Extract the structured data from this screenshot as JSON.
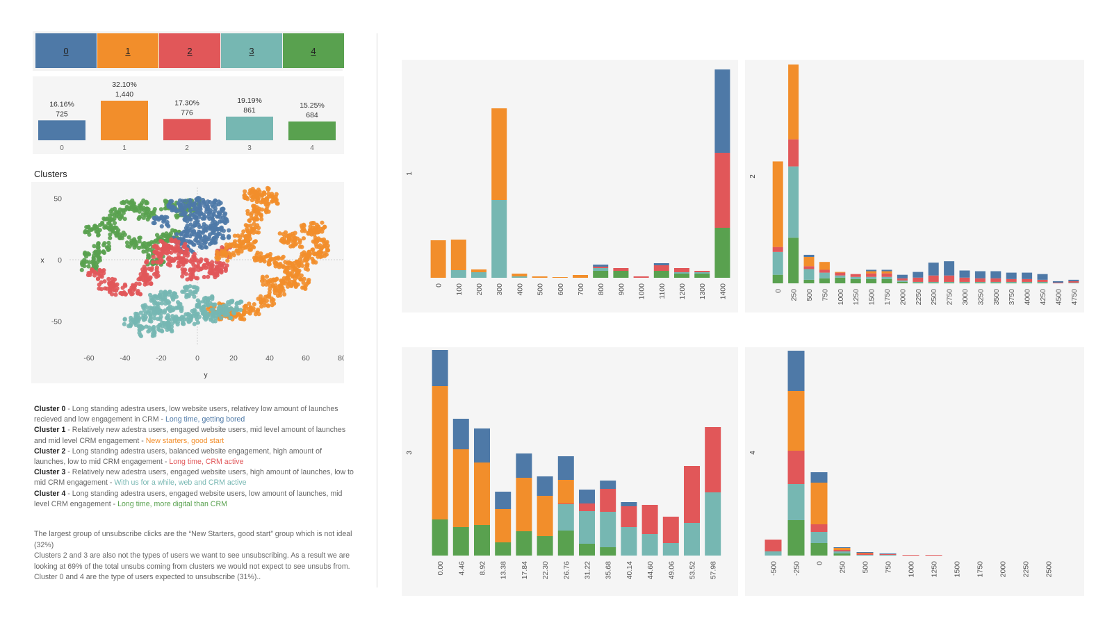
{
  "colors": {
    "c0": "#4e79a7",
    "c1": "#f28e2b",
    "c2": "#e15759",
    "c3": "#76b7b2",
    "c4": "#59a14f"
  },
  "legend": [
    "0",
    "1",
    "2",
    "3",
    "4"
  ],
  "cluster_counts": {
    "type": "bar",
    "categories": [
      "0",
      "1",
      "2",
      "3",
      "4"
    ],
    "percents": [
      "16.16%",
      "32.10%",
      "17.30%",
      "19.19%",
      "15.25%"
    ],
    "counts": [
      "725",
      "1,440",
      "776",
      "861",
      "684"
    ],
    "values": [
      725,
      1440,
      776,
      861,
      684
    ]
  },
  "clusters_title": "Clusters",
  "scatter": {
    "type": "scatter",
    "xlabel": "y",
    "ylabel": "x",
    "xticks": [
      "-60",
      "-40",
      "-20",
      "0",
      "20",
      "40",
      "60",
      "80"
    ],
    "yticks": [
      "50",
      "0",
      "-50"
    ],
    "xlim": [
      -80,
      80
    ],
    "ylim": [
      -75,
      60
    ]
  },
  "descriptions": [
    {
      "title": "Cluster 0",
      "text": " - Long standing adestra users, low website users, relativey low amount of launches recieved and low engagement in CRM - ",
      "tag": "Long time, getting bored",
      "color": "#4e79a7"
    },
    {
      "title": "Cluster 1",
      "text": " - Relatively new adestra users, engaged website users, mid level amount of launches and mid level CRM engagement - ",
      "tag": "New starters, good start",
      "color": "#f28e2b"
    },
    {
      "title": "Cluster 2",
      "text": " - Long standing adestra users, balanced website engagement, high amount of launches, low to mid CRM engagement - ",
      "tag": "Long time, CRM active",
      "color": "#e15759"
    },
    {
      "title": "Cluster 3",
      "text": " - Relatively new adestra users, engaged website users, high amount of launches, low to mid CRM engagement - ",
      "tag": "With us for a while, web and CRM active",
      "color": "#76b7b2"
    },
    {
      "title": "Cluster 4",
      "text": " - Long standing adestra users, engaged website users, low amount of launches, mid level CRM engagement - ",
      "tag": "Long time, more digital than CRM",
      "color": "#59a14f"
    }
  ],
  "summary": [
    "The largest group of unsubscribe clicks are the “New Starters, good start” group which is not ideal (32%)",
    "Clusters 2 and 3 are also not the types of users we want to see unsubscribing. As a result we are looking at 69% of the total unsubs coming from clusters we would not expect to see unsubs from.",
    "Cluster 0 and 4 are the type of users expected to unsubscribe (31%).."
  ],
  "chart_data": [
    {
      "type": "bar",
      "stacked": true,
      "ylabel": "1",
      "categories": [
        "0",
        "100",
        "200",
        "300",
        "400",
        "500",
        "600",
        "700",
        "800",
        "900",
        "1000",
        "1100",
        "1200",
        "1300",
        "1400"
      ],
      "series": [
        {
          "name": "4",
          "values": [
            0,
            0,
            0,
            0,
            0,
            0,
            0,
            0,
            10,
            10,
            0,
            10,
            6,
            6,
            72
          ]
        },
        {
          "name": "3",
          "values": [
            0,
            11,
            8,
            112,
            2,
            0,
            0,
            0,
            4,
            0,
            0,
            0,
            2,
            2,
            0
          ]
        },
        {
          "name": "2",
          "values": [
            0,
            0,
            0,
            0,
            0,
            0,
            0,
            0,
            2,
            4,
            2,
            8,
            6,
            2,
            108
          ]
        },
        {
          "name": "1",
          "values": [
            54,
            44,
            4,
            132,
            4,
            2,
            1,
            4,
            0,
            0,
            0,
            0,
            0,
            0,
            0
          ]
        },
        {
          "name": "0",
          "values": [
            0,
            0,
            0,
            0,
            0,
            0,
            0,
            0,
            3,
            0,
            0,
            3,
            0,
            0,
            120
          ]
        }
      ]
    },
    {
      "type": "bar",
      "stacked": true,
      "ylabel": "2",
      "categories": [
        "0",
        "250",
        "500",
        "750",
        "1000",
        "1250",
        "1500",
        "1750",
        "2000",
        "2250",
        "2500",
        "2750",
        "3000",
        "3250",
        "3500",
        "3750",
        "4000",
        "4250",
        "4500",
        "4750"
      ],
      "series": [
        {
          "name": "4",
          "values": [
            12,
            64,
            5,
            7,
            8,
            6,
            6,
            6,
            2,
            1,
            1,
            1,
            1,
            1,
            1,
            1,
            1,
            1,
            0,
            0
          ]
        },
        {
          "name": "3",
          "values": [
            32,
            100,
            15,
            8,
            3,
            3,
            3,
            3,
            2,
            1,
            1,
            1,
            1,
            1,
            1,
            1,
            1,
            1,
            0,
            1
          ]
        },
        {
          "name": "2",
          "values": [
            7,
            38,
            4,
            4,
            4,
            4,
            5,
            5,
            3,
            6,
            9,
            9,
            6,
            5,
            5,
            4,
            4,
            3,
            1,
            2
          ]
        },
        {
          "name": "1",
          "values": [
            120,
            105,
            13,
            11,
            1,
            0,
            3,
            3,
            0,
            0,
            0,
            0,
            0,
            0,
            0,
            0,
            0,
            0,
            0,
            0
          ]
        },
        {
          "name": "0",
          "values": [
            0,
            0,
            3,
            0,
            0,
            0,
            2,
            2,
            5,
            8,
            18,
            20,
            10,
            10,
            10,
            9,
            9,
            8,
            2,
            2
          ]
        }
      ]
    },
    {
      "type": "bar",
      "stacked": true,
      "ylabel": "3",
      "categories": [
        "0.00",
        "4.46",
        "8.92",
        "13.38",
        "17.84",
        "22.30",
        "26.76",
        "31.22",
        "35.68",
        "40.14",
        "44.60",
        "49.06",
        "53.52",
        "57.98"
      ],
      "series": [
        {
          "name": "4",
          "values": [
            52,
            41,
            44,
            19,
            35,
            28,
            36,
            17,
            12,
            0,
            0,
            0,
            0,
            0
          ]
        },
        {
          "name": "3",
          "values": [
            0,
            0,
            0,
            0,
            0,
            0,
            38,
            47,
            51,
            41,
            31,
            18,
            47,
            91
          ]
        },
        {
          "name": "2",
          "values": [
            0,
            0,
            0,
            0,
            0,
            0,
            1,
            11,
            33,
            30,
            42,
            38,
            82,
            94
          ]
        },
        {
          "name": "1",
          "values": [
            192,
            112,
            90,
            48,
            77,
            58,
            34,
            0,
            0,
            0,
            0,
            0,
            0,
            0
          ]
        },
        {
          "name": "0",
          "values": [
            52,
            44,
            49,
            25,
            35,
            28,
            34,
            20,
            12,
            6,
            0,
            0,
            0,
            0
          ]
        }
      ]
    },
    {
      "type": "bar",
      "stacked": true,
      "ylabel": "4",
      "categories": [
        "-500",
        "-250",
        "0",
        "250",
        "500",
        "750",
        "1000",
        "1250",
        "1500",
        "1750",
        "2000",
        "2250",
        "2500"
      ],
      "series": [
        {
          "name": "4",
          "values": [
            0,
            51,
            18,
            3,
            0,
            0,
            0,
            0,
            0,
            0,
            0,
            0,
            0
          ]
        },
        {
          "name": "3",
          "values": [
            6,
            52,
            16,
            3,
            1,
            1,
            0,
            0,
            0,
            0,
            0,
            0,
            0
          ]
        },
        {
          "name": "2",
          "values": [
            17,
            48,
            11,
            2,
            2,
            1,
            1,
            1,
            0,
            0,
            0,
            0,
            0
          ]
        },
        {
          "name": "1",
          "values": [
            0,
            86,
            60,
            3,
            1,
            0,
            0,
            0,
            0,
            0,
            0,
            0,
            0
          ]
        },
        {
          "name": "0",
          "values": [
            0,
            58,
            15,
            1,
            1,
            1,
            0,
            0,
            0,
            0,
            0,
            0,
            0
          ]
        }
      ]
    }
  ]
}
